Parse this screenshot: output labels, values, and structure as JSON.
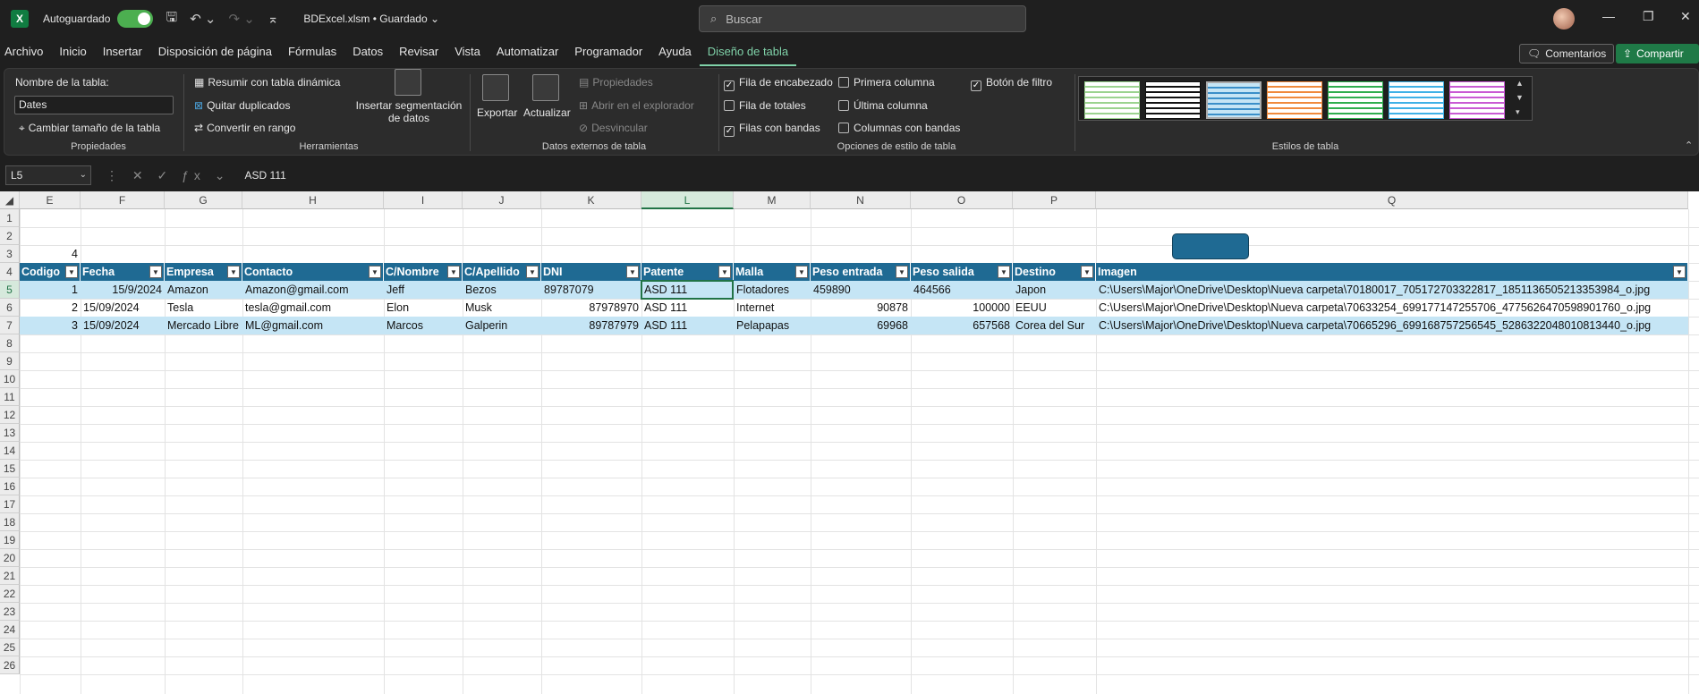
{
  "titlebar": {
    "autosave_label": "Autoguardado",
    "autosave_state": "Sí",
    "doc_title": "BDExcel.xlsm • Guardado ⌄",
    "search_placeholder": "Buscar"
  },
  "menu": {
    "items": [
      "Archivo",
      "Inicio",
      "Insertar",
      "Disposición de página",
      "Fórmulas",
      "Datos",
      "Revisar",
      "Vista",
      "Automatizar",
      "Programador",
      "Ayuda",
      "Diseño de tabla"
    ],
    "active": "Diseño de tabla",
    "comments": "Comentarios",
    "share": "Compartir"
  },
  "ribbon": {
    "propiedades": {
      "name_label": "Nombre de la tabla:",
      "name_value": "Dates",
      "resize": "Cambiar tamaño de la tabla",
      "group": "Propiedades"
    },
    "herramientas": {
      "pivot": "Resumir con tabla dinámica",
      "dedupe": "Quitar duplicados",
      "convert": "Convertir en rango",
      "slicer_line1": "Insertar segmentación",
      "slicer_line2": "de datos",
      "group": "Herramientas"
    },
    "externos": {
      "export": "Exportar",
      "refresh": "Actualizar",
      "properties": "Propiedades",
      "open_browser": "Abrir en el explorador",
      "unlink": "Desvincular",
      "group": "Datos externos de tabla"
    },
    "opciones": {
      "header_row": "Fila de encabezado",
      "totals_row": "Fila de totales",
      "banded_rows": "Filas con bandas",
      "first_col": "Primera columna",
      "last_col": "Última columna",
      "banded_cols": "Columnas con bandas",
      "filter_btn": "Botón de filtro",
      "group": "Opciones de estilo de tabla"
    },
    "estilos": {
      "group": "Estilos de tabla",
      "swatch_colors": [
        "#9bd38f",
        "#111111",
        "#3a8fc9",
        "#f08a3c",
        "#2fae4e",
        "#3fb1e6",
        "#c95ad4"
      ]
    }
  },
  "formula_bar": {
    "name_box": "L5",
    "value": "ASD 111"
  },
  "sheet": {
    "columns": [
      "E",
      "F",
      "G",
      "H",
      "I",
      "J",
      "K",
      "L",
      "M",
      "N",
      "O",
      "P",
      "Q"
    ],
    "rows": [
      "1",
      "2",
      "3",
      "4",
      "5",
      "6",
      "7",
      "8",
      "9",
      "10",
      "11",
      "12",
      "13",
      "14",
      "15",
      "16",
      "17",
      "18",
      "19",
      "20",
      "21",
      "22",
      "23",
      "24",
      "25",
      "26"
    ],
    "e3_value": "4",
    "table_headers": [
      "Codigo",
      "Fecha",
      "Empresa",
      "Contacto",
      "C/Nombre",
      "C/Apellido",
      "DNI",
      "Patente",
      "Malla",
      "Peso entrada",
      "Peso salida",
      "Destino",
      "Imagen"
    ],
    "table_rows": [
      [
        "1",
        "15/9/2024",
        "Amazon",
        "Amazon@gmail.com",
        "Jeff",
        "Bezos",
        "89787079",
        "ASD 111",
        "Flotadores",
        "459890",
        "464566",
        "Japon",
        "C:\\Users\\Major\\OneDrive\\Desktop\\Nueva carpeta\\70180017_705172703322817_1851136505213353984_o.jpg"
      ],
      [
        "2",
        "15/09/2024",
        "Tesla",
        "tesla@gmail.com",
        "Elon",
        "Musk",
        "87978970",
        "ASD 111",
        "Internet",
        "90878",
        "100000",
        "EEUU",
        "C:\\Users\\Major\\OneDrive\\Desktop\\Nueva carpeta\\70633254_699177147255706_4775626470598901760_o.jpg"
      ],
      [
        "3",
        "15/09/2024",
        "Mercado Libre",
        "ML@gmail.com",
        "Marcos",
        "Galperin",
        "89787979",
        "ASD 111",
        "Pelapapas",
        "69968",
        "657568",
        "Corea del Sur",
        "C:\\Users\\Major\\OneDrive\\Desktop\\Nueva carpeta\\70665296_699168757256545_5286322048010813440_o.jpg"
      ]
    ]
  }
}
